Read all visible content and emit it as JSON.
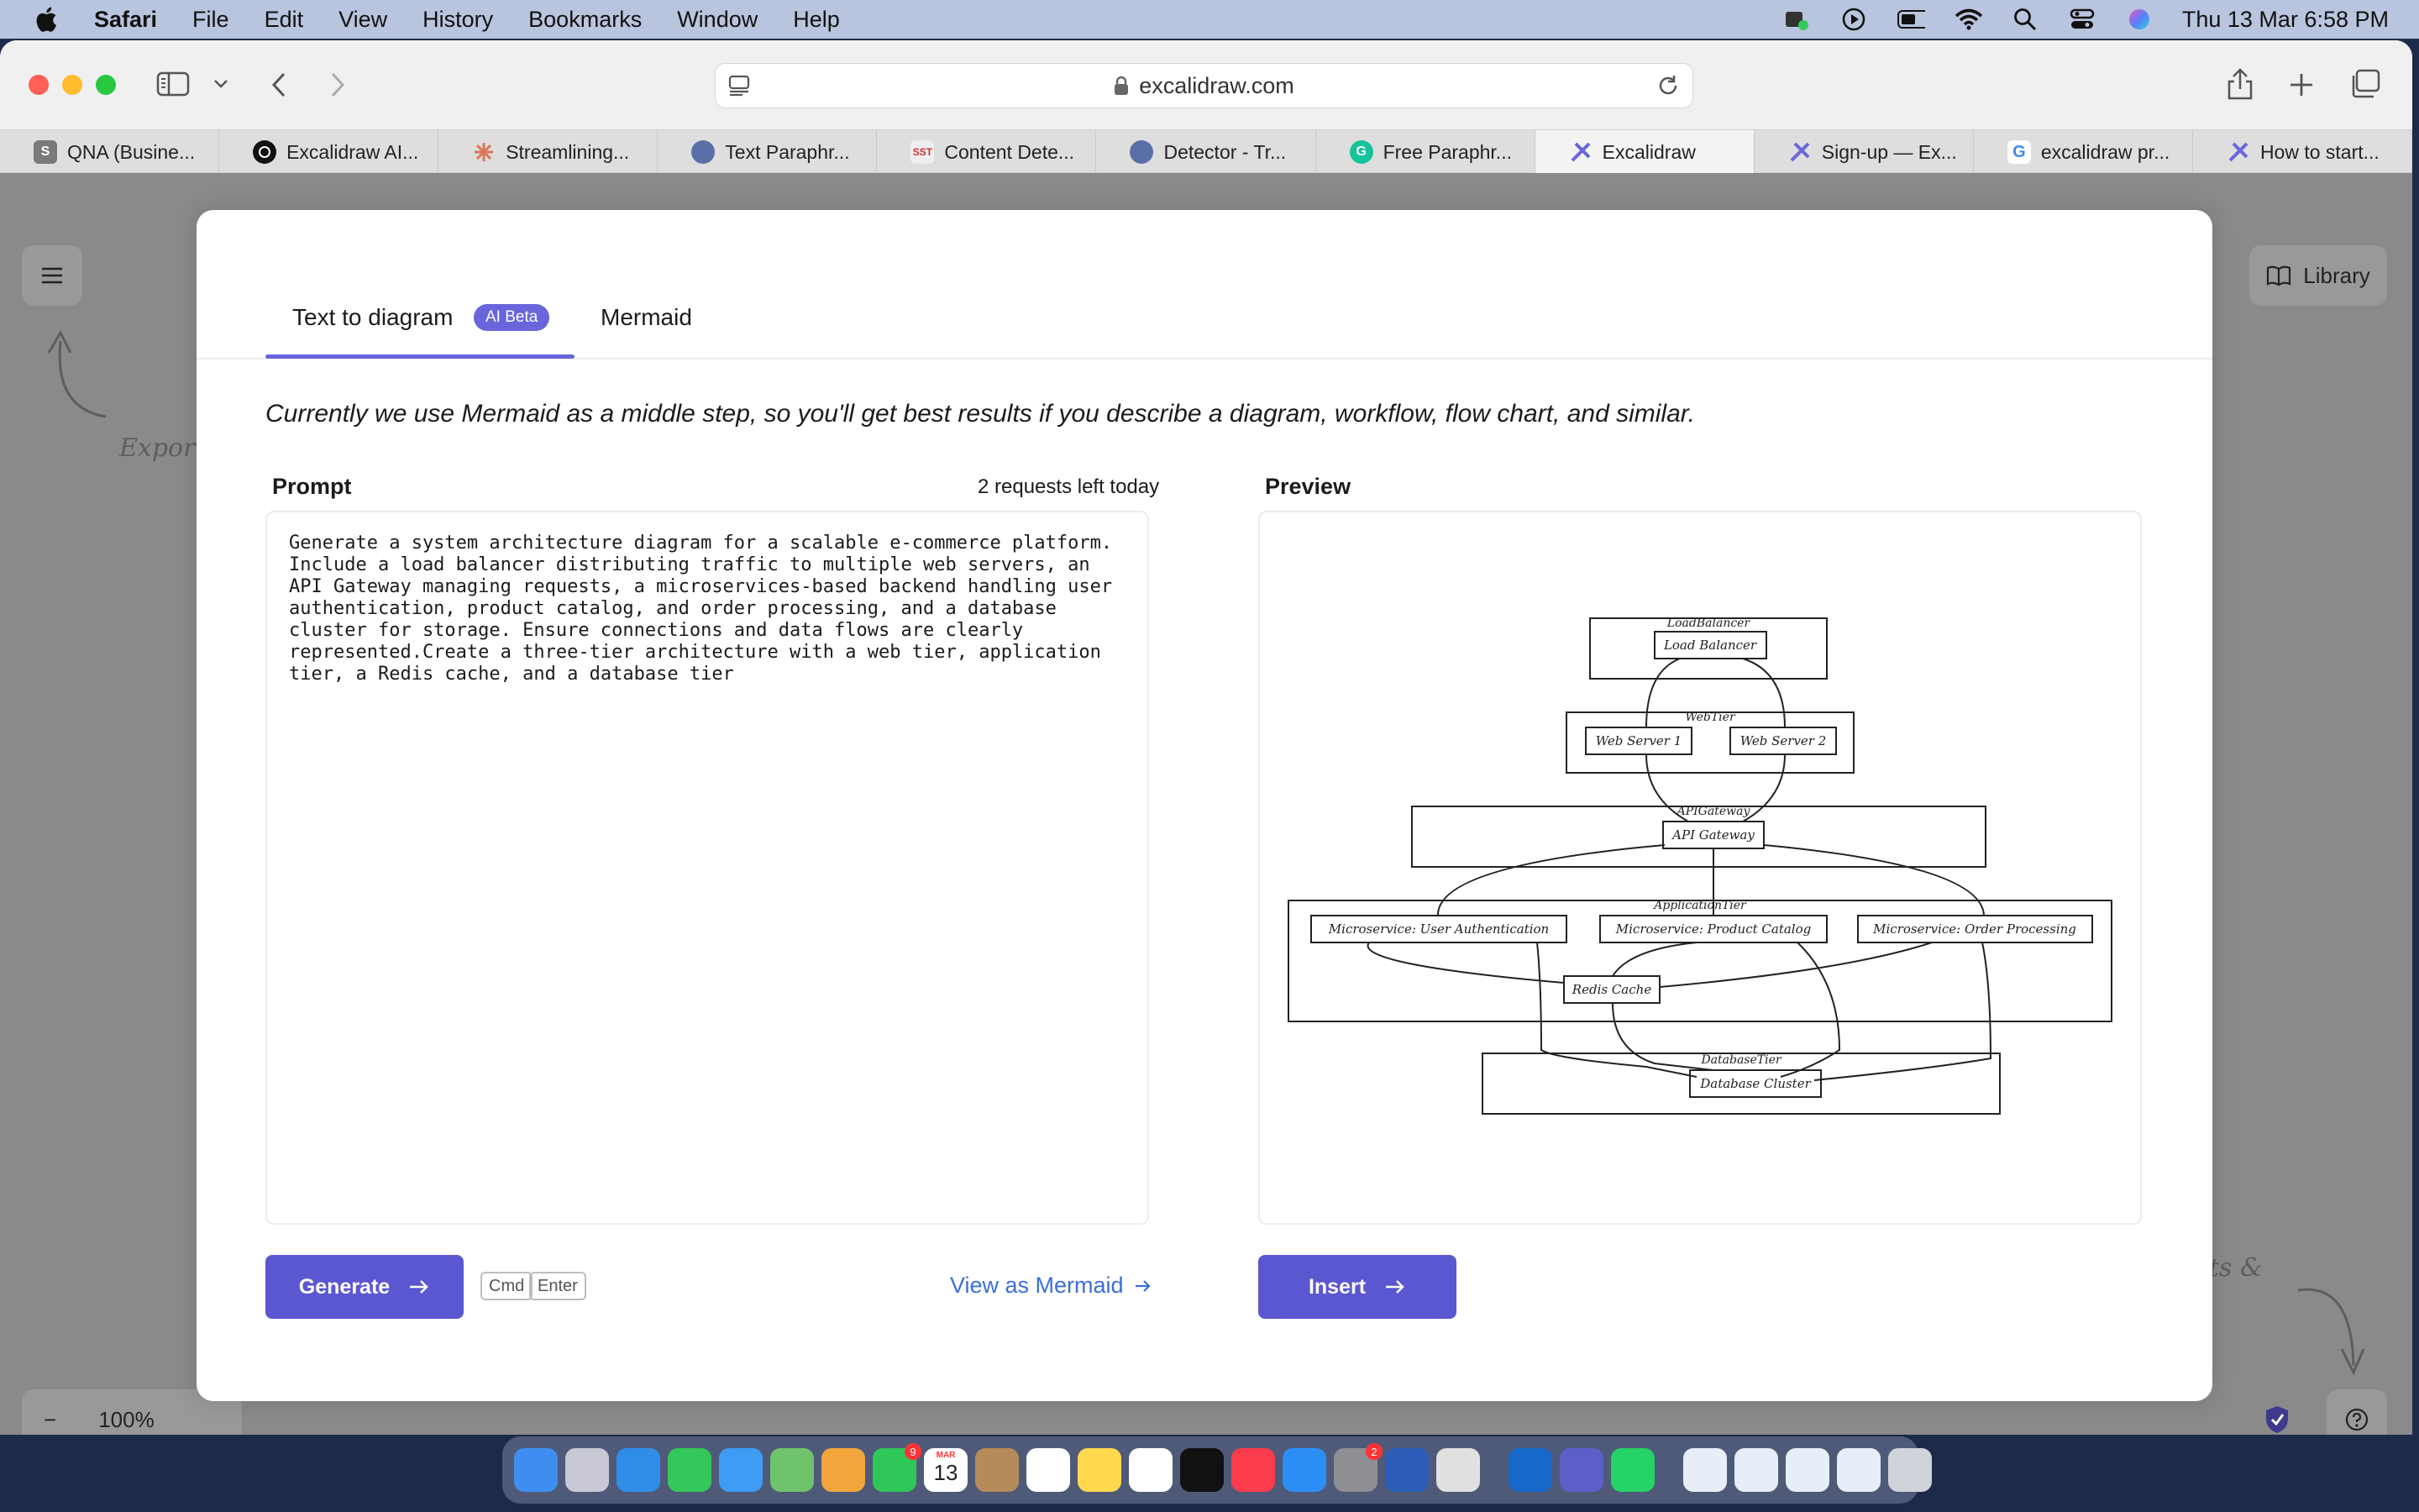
{
  "menubar": {
    "app_name": "Safari",
    "items": [
      "File",
      "Edit",
      "View",
      "History",
      "Bookmarks",
      "Window",
      "Help"
    ],
    "clock": "Thu 13 Mar  6:58 PM"
  },
  "browser": {
    "url": "excalidraw.com",
    "tabs": [
      {
        "label": "QNA (Busine...",
        "icon": "letter-s-icon",
        "color": "#7a7a7a",
        "glyph": "S"
      },
      {
        "label": "Excalidraw AI...",
        "icon": "openai-icon",
        "color": "#111111",
        "glyph": ""
      },
      {
        "label": "Streamlining...",
        "icon": "claude-icon",
        "color": "#d97757",
        "glyph": ""
      },
      {
        "label": "Text Paraphr...",
        "icon": "brain-icon",
        "color": "#5a6fa8",
        "glyph": ""
      },
      {
        "label": "Content Dete...",
        "icon": "sst-icon",
        "color": "#e8e8e8",
        "glyph": "SST"
      },
      {
        "label": "Detector - Tr...",
        "icon": "brain-icon",
        "color": "#5a6fa8",
        "glyph": ""
      },
      {
        "label": "Free Paraphr...",
        "icon": "grammarly-icon",
        "color": "#15c39a",
        "glyph": "G"
      },
      {
        "label": "Excalidraw",
        "icon": "excalidraw-icon",
        "color": "#6965db",
        "glyph": ""
      },
      {
        "label": "Sign-up — Ex...",
        "icon": "excalidraw-icon",
        "color": "#6965db",
        "glyph": ""
      },
      {
        "label": "excalidraw pr...",
        "icon": "google-icon",
        "color": "#4285f4",
        "glyph": "G"
      },
      {
        "label": "How to start...",
        "icon": "excalidraw-icon",
        "color": "#6965db",
        "glyph": ""
      }
    ],
    "active_tab": 7
  },
  "canvas": {
    "library_label": "Library",
    "zoom_label": "100%",
    "zoom_minus": "−",
    "hint_left": "Expor",
    "hint_right": "ts &"
  },
  "modal": {
    "tab_text_to_diagram": "Text to diagram",
    "beta_badge": "AI Beta",
    "tab_mermaid": "Mermaid",
    "description": "Currently we use Mermaid as a middle step, so you'll get best results if you describe a diagram, workflow, flow chart, and similar.",
    "prompt_label": "Prompt",
    "requests_left": "2 requests left today",
    "preview_label": "Preview",
    "prompt_text": "Generate a system architecture diagram for a scalable e-commerce platform.\nInclude a load balancer distributing traffic to multiple web servers, an\nAPI Gateway managing requests, a microservices-based backend handling user\nauthentication, product catalog, and order processing, and a database\ncluster for storage. Ensure connections and data flows are clearly\nrepresented.Create a three-tier architecture with a web tier, application\ntier, a Redis cache, and a database tier",
    "generate_label": "Generate",
    "kbd_cmd": "Cmd",
    "kbd_enter": "Enter",
    "view_mermaid_label": "View as Mermaid",
    "insert_label": "Insert"
  },
  "diagram": {
    "groups": {
      "load_balancer": "LoadBalancer",
      "web_tier": "WebTier",
      "api_gateway": "APIGateway",
      "application_tier": "ApplicationTier",
      "database_tier": "DatabaseTier"
    },
    "nodes": {
      "load_balancer": "Load Balancer",
      "web_server_1": "Web Server 1",
      "web_server_2": "Web Server 2",
      "api_gateway": "API Gateway",
      "ms_auth": "Microservice: User Authentication",
      "ms_catalog": "Microservice: Product Catalog",
      "ms_order": "Microservice: Order Processing",
      "redis": "Redis Cache",
      "db": "Database Cluster"
    }
  },
  "dock": {
    "apps": [
      {
        "name": "finder-icon",
        "color": "#3d8ef0"
      },
      {
        "name": "launchpad-icon",
        "color": "#c9c9d6"
      },
      {
        "name": "safari-icon",
        "color": "#2f8de8"
      },
      {
        "name": "messages-icon",
        "color": "#34c759"
      },
      {
        "name": "mail-icon",
        "color": "#3f9cf5"
      },
      {
        "name": "maps-icon",
        "color": "#6fc36b"
      },
      {
        "name": "photos-icon",
        "color": "#f2a53b"
      },
      {
        "name": "facetime-icon",
        "color": "#30c759"
      },
      {
        "name": "calendar-icon",
        "color": "#ffffff"
      },
      {
        "name": "contacts-icon",
        "color": "#b58b5a"
      },
      {
        "name": "reminders-icon",
        "color": "#ffffff"
      },
      {
        "name": "notes-icon",
        "color": "#ffd84d"
      },
      {
        "name": "freeform-icon",
        "color": "#ffffff"
      },
      {
        "name": "appletv-icon",
        "color": "#111111"
      },
      {
        "name": "music-icon",
        "color": "#fa3c4c"
      },
      {
        "name": "appstore-icon",
        "color": "#2b8ef5"
      },
      {
        "name": "settings-icon",
        "color": "#8e8e93"
      },
      {
        "name": "word-icon",
        "color": "#2b5cb8"
      },
      {
        "name": "iphone-mirroring-icon",
        "color": "#e0e0e0"
      },
      {
        "name": "outlook-icon",
        "color": "#1669c8"
      },
      {
        "name": "teams-icon",
        "color": "#5b5fc7"
      },
      {
        "name": "whatsapp-icon",
        "color": "#25d366"
      },
      {
        "name": "recent-doc-icon",
        "color": "#e8eef7"
      },
      {
        "name": "recent-doc-icon",
        "color": "#e8eef7"
      },
      {
        "name": "recent-doc-icon",
        "color": "#e8eef7"
      },
      {
        "name": "recent-doc-icon",
        "color": "#e8eef7"
      },
      {
        "name": "trash-icon",
        "color": "#cfd3da"
      }
    ],
    "calendar_day": "13",
    "calendar_month": "MAR",
    "facetime_badge": "9",
    "settings_badge": "2"
  },
  "colors": {
    "accent": "#6965db",
    "button": "#5b57d1",
    "link": "#3b6fd8"
  }
}
